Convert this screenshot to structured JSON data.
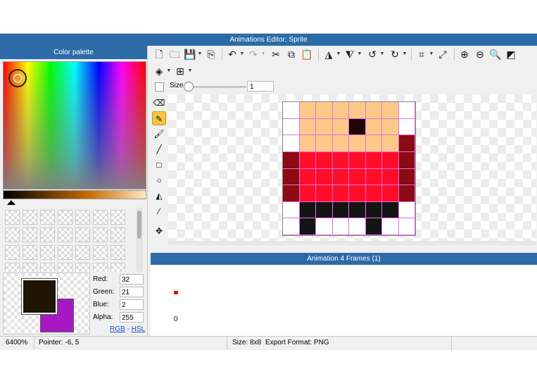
{
  "window": {
    "title": "Animations Editor: Sprite"
  },
  "palette": {
    "title": "Color palette",
    "primary_color": "#201502",
    "secondary_color": "#a619c2",
    "red_label": "Red:",
    "red": "32",
    "green_label": "Green:",
    "green": "21",
    "blue_label": "Blue:",
    "blue": "2",
    "alpha_label": "Alpha:",
    "alpha": "255",
    "mode_rgb": "RGB",
    "mode_sep": " - ",
    "mode_hsl": "HSL"
  },
  "toolbar": {
    "size_label": "Size",
    "size_value": "1",
    "zoom_in_glyph": "⊕",
    "zoom_out_glyph": "⊖"
  },
  "sprite": {
    "width": 8,
    "height": 8,
    "colors": {
      "s": "#fcc98a",
      "e": "#200303",
      "r": "#ff0d2a",
      "d": "#8b0a13",
      "k": "#141414",
      "t": "transparent"
    },
    "rows": [
      "tsssssst",
      "tsssesst",
      "tssssssd",
      "drrrrrrd",
      "drrrrrrd",
      "drrrrrrd",
      "tkkkkkkt",
      "tktttkt"
    ]
  },
  "animation": {
    "title": "Animation 4 Frames (1)",
    "frame_number": "0"
  },
  "status": {
    "zoom": "6400%",
    "pointer": "Pointer: -6, 5",
    "size": "Size: 8x8",
    "export": "Export Format: PNG"
  }
}
